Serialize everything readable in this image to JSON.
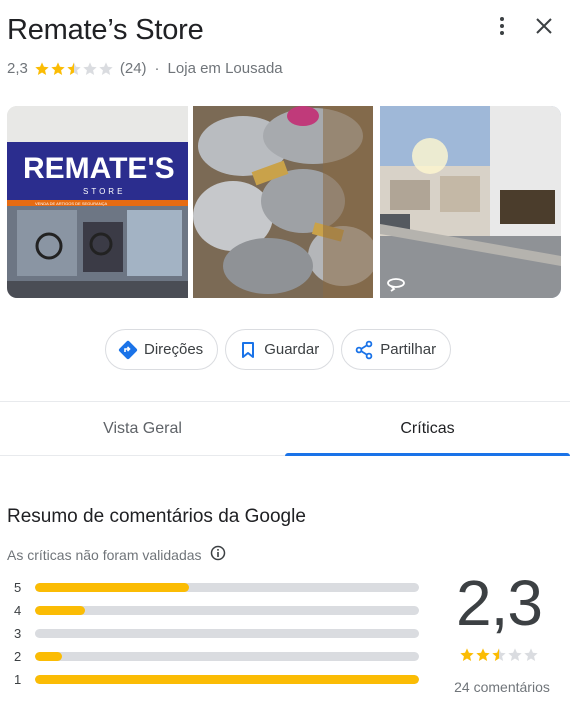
{
  "place": {
    "name": "Remate’s Store",
    "rating": "2,3",
    "rating_value": 2.3,
    "reviews_short": "(24)",
    "separator": "·",
    "category": "Loja em Lousada"
  },
  "photos": {
    "storefront_sign_main": "REMATE'S",
    "storefront_sign_sub": "STORE",
    "storefront_sign_strip": "VENDA DE ARTIGOS DE SEGURANÇA"
  },
  "actions": {
    "directions": "Direções",
    "save": "Guardar",
    "share": "Partilhar"
  },
  "tabs": [
    {
      "label": "Vista Geral",
      "active": false
    },
    {
      "label": "Críticas",
      "active": true
    }
  ],
  "reviews": {
    "summary_title": "Resumo de comentários da Google",
    "not_validated": "As críticas não foram validadas",
    "distribution": [
      {
        "stars": "5",
        "fraction": 0.4
      },
      {
        "stars": "4",
        "fraction": 0.13
      },
      {
        "stars": "3",
        "fraction": 0.0
      },
      {
        "stars": "2",
        "fraction": 0.07
      },
      {
        "stars": "1",
        "fraction": 1.0
      }
    ],
    "average": "2,3",
    "count_label": "24 comentários"
  },
  "colors": {
    "star": "#fbbc04",
    "star_empty": "#dadce0",
    "accent": "#1a73e8"
  }
}
